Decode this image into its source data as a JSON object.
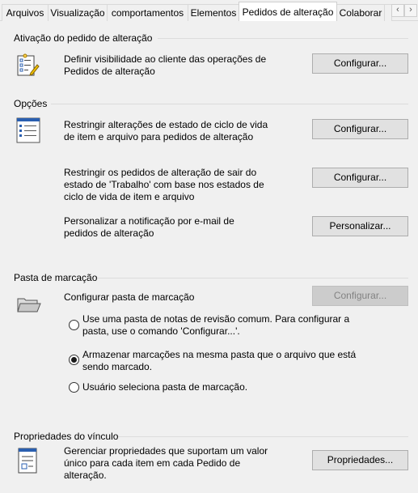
{
  "tabs": [
    {
      "label": "Arquivos"
    },
    {
      "label": "Visualização"
    },
    {
      "label": "comportamentos"
    },
    {
      "label": "Elementos"
    },
    {
      "label": "Pedidos de alteração",
      "active": true
    },
    {
      "label": "Colaborar"
    }
  ],
  "tab_scroll": {
    "left": "‹",
    "right": "›"
  },
  "sections": {
    "activation": {
      "title": "Ativação do pedido de alteração",
      "row": {
        "icon": "checklist-pencil-icon",
        "desc_line1": "Definir visibilidade ao cliente das operações de",
        "desc_line2": "Pedidos de alteração",
        "button": "Configurar..."
      }
    },
    "options": {
      "title": "Opções",
      "rows": [
        {
          "icon": "list-form-icon",
          "desc_line1": "Restringir alterações de estado de ciclo de vida",
          "desc_line2": "de item e arquivo para pedidos de alteração",
          "button": "Configurar..."
        },
        {
          "desc_line1": "Restringir os pedidos de alteração de sair do",
          "desc_line2": "estado de 'Trabalho' com base nos estados de",
          "desc_line3": "ciclo de vida de item e arquivo",
          "button": "Configurar..."
        },
        {
          "desc_line1": "Personalizar a notificação por e-mail de",
          "desc_line2": "pedidos de alteração",
          "button": "Personalizar..."
        }
      ]
    },
    "markup": {
      "title": "Pasta de marcação",
      "icon": "folder-open-icon",
      "desc": "Configurar pasta de marcação",
      "button": "Configurar...",
      "button_disabled": true,
      "options": [
        {
          "line1": "Use uma pasta de notas de revisão comum. Para configurar a",
          "line2": "pasta, use o comando 'Configurar...'.",
          "selected": false
        },
        {
          "line1": "Armazenar marcações na mesma pasta que o arquivo que está",
          "line2": "sendo marcado.",
          "selected": true
        },
        {
          "line1": "Usuário seleciona pasta de marcação.",
          "line2": "",
          "selected": false
        }
      ]
    },
    "link": {
      "title": "Propriedades do vínculo",
      "icon": "property-sheet-icon",
      "desc_line1": "Gerenciar propriedades que suportam um valor",
      "desc_line2": "único para cada item em cada Pedido de",
      "desc_line3": "alteração.",
      "button": "Propriedades..."
    }
  }
}
